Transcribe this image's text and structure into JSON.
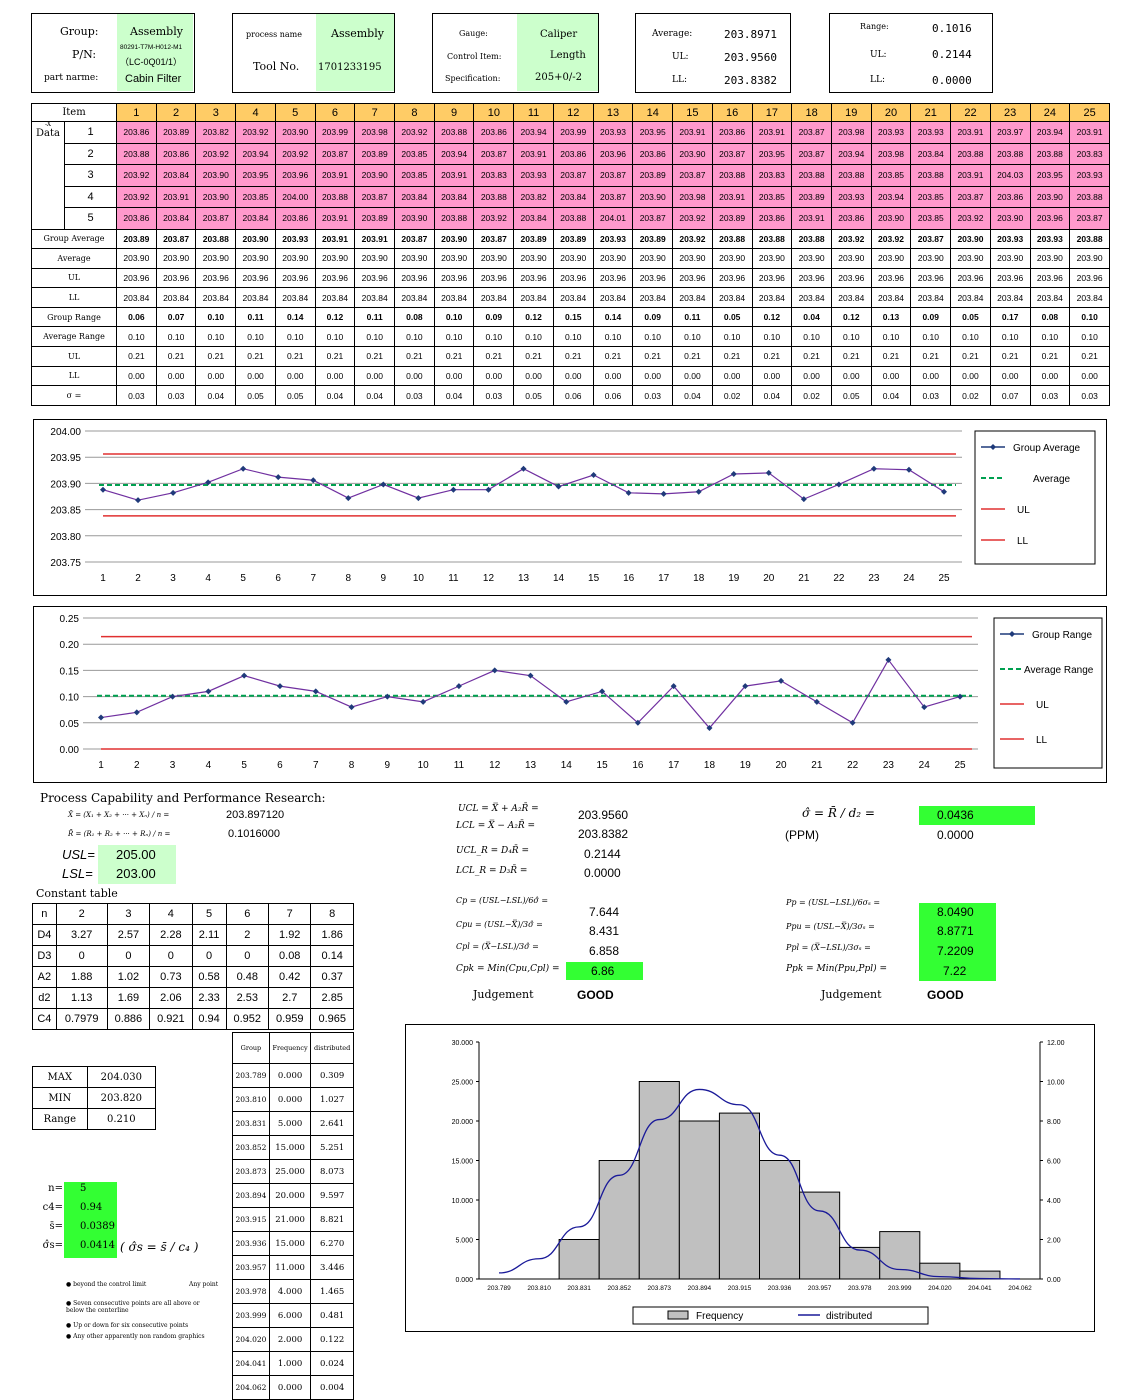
{
  "header": {
    "group_label": "Group:",
    "group_value": "Assembly",
    "pn_label": "P/N:",
    "pn_value1": "80291-T7M-H012-M1",
    "pn_value2": "（LC-0Q01/1）",
    "part_label": "part narme:",
    "part_value": "Cabin Filter",
    "process_label": "process name",
    "process_value": "Assembly",
    "tool_label": "Tool No.",
    "tool_value": "1701233195",
    "gauge_label": "Gauge:",
    "gauge_value": "Caliper",
    "item_label": "Control Item:",
    "item_value": "Length",
    "spec_label": "Specification:",
    "spec_value": "205+0/-2",
    "avg_label": "Average:",
    "avg_value": "203.8971",
    "ul_label": "UL:",
    "ul_value": "203.9560",
    "ll_label": "LL:",
    "ll_value": "203.8382",
    "range_label": "Range:",
    "range_value": "0.1016",
    "rul_label": "UL:",
    "rul_value": "0.2144",
    "rll_label": "LL:",
    "rll_value": "0.0000"
  },
  "data_table": {
    "item_label": "Item",
    "data_label": "Data",
    "data_sub": "-X",
    "columns": [
      "1",
      "2",
      "3",
      "4",
      "5",
      "6",
      "7",
      "8",
      "9",
      "10",
      "11",
      "12",
      "13",
      "14",
      "15",
      "16",
      "17",
      "18",
      "19",
      "20",
      "21",
      "22",
      "23",
      "24",
      "25"
    ],
    "row_labels": [
      "1",
      "2",
      "3",
      "4",
      "5"
    ],
    "rows": [
      [
        "203.86",
        "203.89",
        "203.82",
        "203.92",
        "203.90",
        "203.99",
        "203.98",
        "203.92",
        "203.88",
        "203.86",
        "203.94",
        "203.99",
        "203.93",
        "203.95",
        "203.91",
        "203.86",
        "203.91",
        "203.87",
        "203.98",
        "203.93",
        "203.93",
        "203.91",
        "203.97",
        "203.94",
        "203.91"
      ],
      [
        "203.88",
        "203.86",
        "203.92",
        "203.94",
        "203.92",
        "203.87",
        "203.89",
        "203.85",
        "203.94",
        "203.87",
        "203.91",
        "203.86",
        "203.96",
        "203.86",
        "203.90",
        "203.87",
        "203.95",
        "203.87",
        "203.94",
        "203.98",
        "203.84",
        "203.88",
        "203.88",
        "203.88",
        "203.83"
      ],
      [
        "203.92",
        "203.84",
        "203.90",
        "203.95",
        "203.96",
        "203.91",
        "203.90",
        "203.85",
        "203.91",
        "203.83",
        "203.93",
        "203.87",
        "203.87",
        "203.89",
        "203.87",
        "203.88",
        "203.83",
        "203.88",
        "203.88",
        "203.85",
        "203.88",
        "203.91",
        "204.03",
        "203.95",
        "203.93"
      ],
      [
        "203.92",
        "203.91",
        "203.90",
        "203.85",
        "204.00",
        "203.88",
        "203.87",
        "203.84",
        "203.84",
        "203.88",
        "203.82",
        "203.84",
        "203.87",
        "203.90",
        "203.98",
        "203.91",
        "203.85",
        "203.89",
        "203.93",
        "203.94",
        "203.85",
        "203.87",
        "203.86",
        "203.90",
        "203.88"
      ],
      [
        "203.86",
        "203.84",
        "203.87",
        "203.84",
        "203.86",
        "203.91",
        "203.89",
        "203.90",
        "203.88",
        "203.92",
        "203.84",
        "203.88",
        "204.01",
        "203.87",
        "203.92",
        "203.89",
        "203.86",
        "203.91",
        "203.86",
        "203.90",
        "203.85",
        "203.92",
        "203.90",
        "203.96",
        "203.87"
      ]
    ],
    "stat_rows": [
      {
        "label": "Group Average",
        "bold": true,
        "values": [
          "203.89",
          "203.87",
          "203.88",
          "203.90",
          "203.93",
          "203.91",
          "203.91",
          "203.87",
          "203.90",
          "203.87",
          "203.89",
          "203.89",
          "203.93",
          "203.89",
          "203.92",
          "203.88",
          "203.88",
          "203.88",
          "203.92",
          "203.92",
          "203.87",
          "203.90",
          "203.93",
          "203.93",
          "203.88"
        ]
      },
      {
        "label": "Average",
        "bold": false,
        "values": [
          "203.90",
          "203.90",
          "203.90",
          "203.90",
          "203.90",
          "203.90",
          "203.90",
          "203.90",
          "203.90",
          "203.90",
          "203.90",
          "203.90",
          "203.90",
          "203.90",
          "203.90",
          "203.90",
          "203.90",
          "203.90",
          "203.90",
          "203.90",
          "203.90",
          "203.90",
          "203.90",
          "203.90",
          "203.90"
        ]
      },
      {
        "label": "UL",
        "bold": false,
        "values": [
          "203.96",
          "203.96",
          "203.96",
          "203.96",
          "203.96",
          "203.96",
          "203.96",
          "203.96",
          "203.96",
          "203.96",
          "203.96",
          "203.96",
          "203.96",
          "203.96",
          "203.96",
          "203.96",
          "203.96",
          "203.96",
          "203.96",
          "203.96",
          "203.96",
          "203.96",
          "203.96",
          "203.96",
          "203.96"
        ]
      },
      {
        "label": "LL",
        "bold": false,
        "values": [
          "203.84",
          "203.84",
          "203.84",
          "203.84",
          "203.84",
          "203.84",
          "203.84",
          "203.84",
          "203.84",
          "203.84",
          "203.84",
          "203.84",
          "203.84",
          "203.84",
          "203.84",
          "203.84",
          "203.84",
          "203.84",
          "203.84",
          "203.84",
          "203.84",
          "203.84",
          "203.84",
          "203.84",
          "203.84"
        ]
      },
      {
        "label": "Group Range",
        "bold": true,
        "values": [
          "0.06",
          "0.07",
          "0.10",
          "0.11",
          "0.14",
          "0.12",
          "0.11",
          "0.08",
          "0.10",
          "0.09",
          "0.12",
          "0.15",
          "0.14",
          "0.09",
          "0.11",
          "0.05",
          "0.12",
          "0.04",
          "0.12",
          "0.13",
          "0.09",
          "0.05",
          "0.17",
          "0.08",
          "0.10"
        ]
      },
      {
        "label": "Average Range",
        "bold": false,
        "values": [
          "0.10",
          "0.10",
          "0.10",
          "0.10",
          "0.10",
          "0.10",
          "0.10",
          "0.10",
          "0.10",
          "0.10",
          "0.10",
          "0.10",
          "0.10",
          "0.10",
          "0.10",
          "0.10",
          "0.10",
          "0.10",
          "0.10",
          "0.10",
          "0.10",
          "0.10",
          "0.10",
          "0.10",
          "0.10"
        ]
      },
      {
        "label": "UL",
        "bold": false,
        "values": [
          "0.21",
          "0.21",
          "0.21",
          "0.21",
          "0.21",
          "0.21",
          "0.21",
          "0.21",
          "0.21",
          "0.21",
          "0.21",
          "0.21",
          "0.21",
          "0.21",
          "0.21",
          "0.21",
          "0.21",
          "0.21",
          "0.21",
          "0.21",
          "0.21",
          "0.21",
          "0.21",
          "0.21",
          "0.21"
        ]
      },
      {
        "label": "LL",
        "bold": false,
        "values": [
          "0.00",
          "0.00",
          "0.00",
          "0.00",
          "0.00",
          "0.00",
          "0.00",
          "0.00",
          "0.00",
          "0.00",
          "0.00",
          "0.00",
          "0.00",
          "0.00",
          "0.00",
          "0.00",
          "0.00",
          "0.00",
          "0.00",
          "0.00",
          "0.00",
          "0.00",
          "0.00",
          "0.00",
          "0.00"
        ]
      },
      {
        "label": "σ =",
        "bold": false,
        "values": [
          "0.03",
          "0.03",
          "0.04",
          "0.05",
          "0.05",
          "0.04",
          "0.04",
          "0.03",
          "0.04",
          "0.03",
          "0.05",
          "0.06",
          "0.06",
          "0.03",
          "0.04",
          "0.02",
          "0.04",
          "0.02",
          "0.05",
          "0.04",
          "0.03",
          "0.02",
          "0.07",
          "0.03",
          "0.03"
        ]
      }
    ]
  },
  "chart_data": [
    {
      "type": "line",
      "x": [
        1,
        2,
        3,
        4,
        5,
        6,
        7,
        8,
        9,
        10,
        11,
        12,
        13,
        14,
        15,
        16,
        17,
        18,
        19,
        20,
        21,
        22,
        23,
        24,
        25
      ],
      "ylim": [
        203.75,
        204.0
      ],
      "yticks": [
        "203.75",
        "203.80",
        "203.85",
        "203.90",
        "203.95",
        "204.00"
      ],
      "series": [
        {
          "name": "Group  Average",
          "color": "#7030a0",
          "values": [
            203.888,
            203.868,
            203.882,
            203.902,
            203.928,
            203.912,
            203.906,
            203.872,
            203.898,
            203.872,
            203.888,
            203.888,
            203.928,
            203.894,
            203.916,
            203.882,
            203.88,
            203.884,
            203.918,
            203.92,
            203.87,
            203.898,
            203.928,
            203.926,
            203.884
          ]
        },
        {
          "name": "Average",
          "color": "#00a050",
          "values": [
            203.897
          ]
        },
        {
          "name": "UL",
          "color": "#e03030",
          "values": [
            203.956
          ]
        },
        {
          "name": "LL",
          "color": "#e03030",
          "values": [
            203.838
          ]
        }
      ]
    },
    {
      "type": "line",
      "x": [
        1,
        2,
        3,
        4,
        5,
        6,
        7,
        8,
        9,
        10,
        11,
        12,
        13,
        14,
        15,
        16,
        17,
        18,
        19,
        20,
        21,
        22,
        23,
        24,
        25
      ],
      "ylim": [
        0.0,
        0.25
      ],
      "yticks": [
        "0.00",
        "0.05",
        "0.10",
        "0.15",
        "0.20",
        "0.25"
      ],
      "series": [
        {
          "name": "Group  Range",
          "color": "#7030a0",
          "values": [
            0.06,
            0.07,
            0.1,
            0.11,
            0.14,
            0.12,
            0.11,
            0.08,
            0.1,
            0.09,
            0.12,
            0.15,
            0.14,
            0.09,
            0.11,
            0.05,
            0.12,
            0.04,
            0.12,
            0.13,
            0.09,
            0.05,
            0.17,
            0.08,
            0.1
          ]
        },
        {
          "name": "Average Range",
          "color": "#00a050",
          "values": [
            0.1016
          ]
        },
        {
          "name": "UL",
          "color": "#e03030",
          "values": [
            0.2144
          ]
        },
        {
          "name": "LL",
          "color": "#e03030",
          "values": [
            0.0
          ]
        }
      ]
    },
    {
      "type": "bar",
      "categories": [
        "203.789",
        "203.810",
        "203.831",
        "203.852",
        "203.873",
        "203.894",
        "203.915",
        "203.936",
        "203.957",
        "203.978",
        "203.999",
        "204.020",
        "204.041",
        "204.062"
      ],
      "ylim": [
        0,
        30
      ],
      "y2lim": [
        0,
        12
      ],
      "yticks": [
        "0.000",
        "5.000",
        "10.000",
        "15.000",
        "20.000",
        "25.000",
        "30.000"
      ],
      "y2ticks": [
        "0.00",
        "2.00",
        "4.00",
        "6.00",
        "8.00",
        "10.00",
        "12.00"
      ],
      "series": [
        {
          "name": "Frequency",
          "values": [
            0,
            0,
            5,
            15,
            25,
            20,
            21,
            15,
            11,
            4,
            6,
            2,
            1,
            0
          ]
        },
        {
          "name": "distributed",
          "values": [
            0.309,
            1.027,
            2.641,
            5.251,
            8.073,
            9.597,
            8.821,
            6.27,
            3.446,
            1.465,
            0.481,
            0.122,
            0.024,
            0.004
          ]
        }
      ]
    }
  ],
  "chart_labels": {
    "avg_legend": [
      "Group  Average",
      "Average",
      "UL",
      "LL"
    ],
    "range_legend": [
      "Group  Range",
      "Average Range",
      "UL",
      "LL"
    ],
    "xticks": [
      "1",
      "2",
      "3",
      "4",
      "5",
      "6",
      "7",
      "8",
      "9",
      "10",
      "11",
      "12",
      "13",
      "14",
      "15",
      "16",
      "17",
      "18",
      "19",
      "20",
      "21",
      "22",
      "23",
      "24",
      "25"
    ]
  },
  "capability": {
    "title": "Process Capability and Performance Research:",
    "xbar_formula": "X̄ = (X₁ + X₂ + ··· + Xₙ) / n =",
    "xbar_value": "203.897120",
    "rbar_formula": "R̄ = (R₁ + R₂ + ··· + Rₙ) / n =",
    "rbar_value": "0.1016000",
    "usl_label": "USL=",
    "usl_value": "205.00",
    "lsl_label": "LSL=",
    "lsl_value": "203.00",
    "uclx": "UCL = X̿ + A₂R̄ =",
    "uclx_value": "203.9560",
    "lclx": "LCL = X̿ − A₂R̄ =",
    "lclx_value": "203.8382",
    "uclr": "UCL_R = D₄R̄ =",
    "uclr_value": "0.2144",
    "lclr": "LCL_R = D₃R̄ =",
    "lclr_value": "0.0000",
    "cp": "Cp = (USL−LSL)/6σ̂ =",
    "cp_value": "7.644",
    "cpu": "Cpu = (USL−X̿)/3σ̂ =",
    "cpu_value": "8.431",
    "cpl": "Cpl = (X̿−LSL)/3σ̂ =",
    "cpl_value": "6.858",
    "cpk": "Cpk = Min(Cpu,Cpl) =",
    "cpk_value": "6.86",
    "judgement_label": "Judgement",
    "judgement_value": "GOOD",
    "sigma": "σ̂ = R̄ / d₂ =",
    "sigma_value": "0.0436",
    "ppm_label": "(PPM)",
    "ppm_value": "0.0000",
    "pp": "Pp = (USL−LSL)/6σₛ =",
    "pp_value": "8.0490",
    "ppu": "Ppu = (USL−X̿)/3σₛ =",
    "ppu_value": "8.8771",
    "ppl": "Ppl = (X̿−LSL)/3σₛ =",
    "ppl_value": "7.2209",
    "ppk": "Ppk = Min(Ppu,Ppl) =",
    "ppk_value": "7.22",
    "judgement2_label": "Judgement",
    "judgement2_value": "GOOD"
  },
  "constant_table": {
    "title": "Constant table",
    "header": [
      "n",
      "2",
      "3",
      "4",
      "5",
      "6",
      "7",
      "8"
    ],
    "rows": [
      [
        "D4",
        "3.27",
        "2.57",
        "2.28",
        "2.11",
        "2",
        "1.92",
        "1.86"
      ],
      [
        "D3",
        "0",
        "0",
        "0",
        "0",
        "0",
        "0.08",
        "0.14"
      ],
      [
        "A2",
        "1.88",
        "1.02",
        "0.73",
        "0.58",
        "0.48",
        "0.42",
        "0.37"
      ],
      [
        "d2",
        "1.13",
        "1.69",
        "2.06",
        "2.33",
        "2.53",
        "2.7",
        "2.85"
      ],
      [
        "C4",
        "0.7979",
        "0.886",
        "0.921",
        "0.94",
        "0.952",
        "0.959",
        "0.965"
      ]
    ]
  },
  "minmax": {
    "rows": [
      [
        "MAX",
        "204.030"
      ],
      [
        "MIN",
        "203.820"
      ],
      [
        "Range",
        "0.210"
      ]
    ]
  },
  "freq_table": {
    "header": [
      "Group",
      "Frequency",
      "distributed"
    ],
    "rows": [
      [
        "203.789",
        "0.000",
        "0.309"
      ],
      [
        "203.810",
        "0.000",
        "1.027"
      ],
      [
        "203.831",
        "5.000",
        "2.641"
      ],
      [
        "203.852",
        "15.000",
        "5.251"
      ],
      [
        "203.873",
        "25.000",
        "8.073"
      ],
      [
        "203.894",
        "20.000",
        "9.597"
      ],
      [
        "203.915",
        "21.000",
        "8.821"
      ],
      [
        "203.936",
        "15.000",
        "6.270"
      ],
      [
        "203.957",
        "11.000",
        "3.446"
      ],
      [
        "203.978",
        "4.000",
        "1.465"
      ],
      [
        "203.999",
        "6.000",
        "0.481"
      ],
      [
        "204.020",
        "2.000",
        "0.122"
      ],
      [
        "204.041",
        "1.000",
        "0.024"
      ],
      [
        "204.062",
        "0.000",
        "0.004"
      ]
    ]
  },
  "sigma_s": {
    "labels": [
      "n=",
      "c4=",
      "s̄=",
      "σ̂s="
    ],
    "values": [
      "5",
      "0.94",
      "0.0389",
      "0.0414"
    ],
    "formula": "( σ̂s = s̄ / c₄ )"
  },
  "notes": [
    "beyond the control limit",
    "Any point",
    "Seven consecutive points are all above or below the centerline",
    "Up or down for six consecutive points",
    "Any other apparently non random graphics"
  ],
  "colors": {
    "pink": "#ff99cc",
    "orange": "#ffcc66",
    "green": "#ccffcc",
    "bright_green": "#33ff33",
    "series": "#7030a0",
    "avg_line": "#00a050",
    "limit_line": "#e03030"
  }
}
